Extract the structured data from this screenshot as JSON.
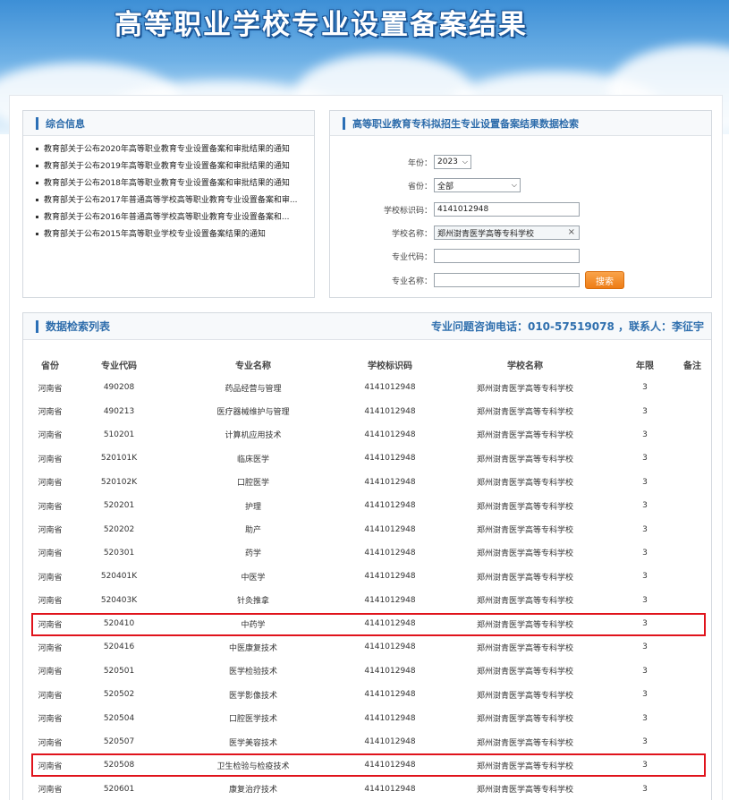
{
  "banner": {
    "title": "高等职业学校专业设置备案结果"
  },
  "info_panel": {
    "title": "综合信息",
    "items": [
      "教育部关于公布2020年高等职业教育专业设置备案和审批结果的通知",
      "教育部关于公布2019年高等职业教育专业设置备案和审批结果的通知",
      "教育部关于公布2018年高等职业教育专业设置备案和审批结果的通知",
      "教育部关于公布2017年普通高等学校高等职业教育专业设置备案和审...",
      "教育部关于公布2016年普通高等学校高等职业教育专业设置备案和...",
      "教育部关于公布2015年高等职业学校专业设置备案结果的通知"
    ]
  },
  "search_panel": {
    "title": "高等职业教育专科拟招生专业设置备案结果数据检索",
    "year_label": "年份：",
    "year_value": "2023",
    "province_label": "省份：",
    "province_value": "全部",
    "school_id_label": "学校标识码：",
    "school_id_value": "4141012948",
    "school_name_label": "学校名称：",
    "school_name_value": "郑州澍青医学高等专科学校",
    "major_code_label": "专业代码：",
    "major_code_value": "",
    "major_name_label": "专业名称：",
    "major_name_value": "",
    "search_button": "搜索"
  },
  "list_panel": {
    "title": "数据检索列表",
    "contact": "专业问题咨询电话：010-57519078 ，联系人：李征宇",
    "columns": [
      "省份",
      "专业代码",
      "专业名称",
      "学校标识码",
      "学校名称",
      "年限",
      "备注"
    ],
    "rows": [
      [
        "河南省",
        "490208",
        "药品经营与管理",
        "4141012948",
        "郑州澍青医学高等专科学校",
        "3",
        ""
      ],
      [
        "河南省",
        "490213",
        "医疗器械维护与管理",
        "4141012948",
        "郑州澍青医学高等专科学校",
        "3",
        ""
      ],
      [
        "河南省",
        "510201",
        "计算机应用技术",
        "4141012948",
        "郑州澍青医学高等专科学校",
        "3",
        ""
      ],
      [
        "河南省",
        "520101K",
        "临床医学",
        "4141012948",
        "郑州澍青医学高等专科学校",
        "3",
        ""
      ],
      [
        "河南省",
        "520102K",
        "口腔医学",
        "4141012948",
        "郑州澍青医学高等专科学校",
        "3",
        ""
      ],
      [
        "河南省",
        "520201",
        "护理",
        "4141012948",
        "郑州澍青医学高等专科学校",
        "3",
        ""
      ],
      [
        "河南省",
        "520202",
        "助产",
        "4141012948",
        "郑州澍青医学高等专科学校",
        "3",
        ""
      ],
      [
        "河南省",
        "520301",
        "药学",
        "4141012948",
        "郑州澍青医学高等专科学校",
        "3",
        ""
      ],
      [
        "河南省",
        "520401K",
        "中医学",
        "4141012948",
        "郑州澍青医学高等专科学校",
        "3",
        ""
      ],
      [
        "河南省",
        "520403K",
        "针灸推拿",
        "4141012948",
        "郑州澍青医学高等专科学校",
        "3",
        ""
      ],
      [
        "河南省",
        "520410",
        "中药学",
        "4141012948",
        "郑州澍青医学高等专科学校",
        "3",
        ""
      ],
      [
        "河南省",
        "520416",
        "中医康复技术",
        "4141012948",
        "郑州澍青医学高等专科学校",
        "3",
        ""
      ],
      [
        "河南省",
        "520501",
        "医学检验技术",
        "4141012948",
        "郑州澍青医学高等专科学校",
        "3",
        ""
      ],
      [
        "河南省",
        "520502",
        "医学影像技术",
        "4141012948",
        "郑州澍青医学高等专科学校",
        "3",
        ""
      ],
      [
        "河南省",
        "520504",
        "口腔医学技术",
        "4141012948",
        "郑州澍青医学高等专科学校",
        "3",
        ""
      ],
      [
        "河南省",
        "520507",
        "医学美容技术",
        "4141012948",
        "郑州澍青医学高等专科学校",
        "3",
        ""
      ],
      [
        "河南省",
        "520508",
        "卫生检验与检疫技术",
        "4141012948",
        "郑州澍青医学高等专科学校",
        "3",
        ""
      ],
      [
        "河南省",
        "520601",
        "康复治疗技术",
        "4141012948",
        "郑州澍青医学高等专科学校",
        "3",
        ""
      ]
    ],
    "highlighted_rows": [
      10,
      16
    ],
    "highlight_color": "#e0131b"
  }
}
